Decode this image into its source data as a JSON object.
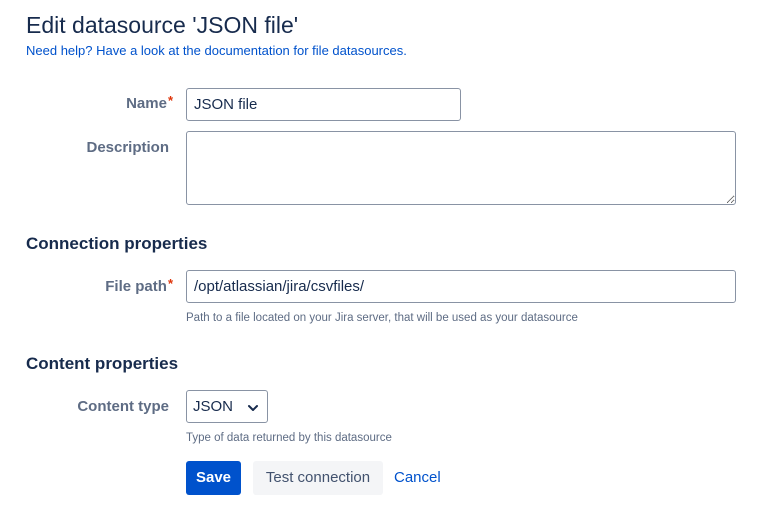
{
  "page": {
    "title": "Edit datasource 'JSON file'",
    "help_link": "Need help? Have a look at the documentation for file datasources."
  },
  "form": {
    "name": {
      "label": "Name",
      "required_marker": "*",
      "value": "JSON file"
    },
    "description": {
      "label": "Description",
      "value": ""
    },
    "connection": {
      "heading": "Connection properties",
      "file_path": {
        "label": "File path",
        "required_marker": "*",
        "value": "/opt/atlassian/jira/csvfiles/",
        "hint": "Path to a file located on your Jira server, that will be used as your datasource"
      }
    },
    "content": {
      "heading": "Content properties",
      "content_type": {
        "label": "Content type",
        "selected": "JSON",
        "hint": "Type of data returned by this datasource"
      }
    }
  },
  "actions": {
    "save_label": "Save",
    "test_label": "Test connection",
    "cancel_label": "Cancel"
  },
  "colors": {
    "primary": "#0052cc",
    "required": "#de350b",
    "text": "#172b4d",
    "label": "#5e6c84"
  },
  "icons": {
    "select_chevron": "chevron-down-icon"
  }
}
